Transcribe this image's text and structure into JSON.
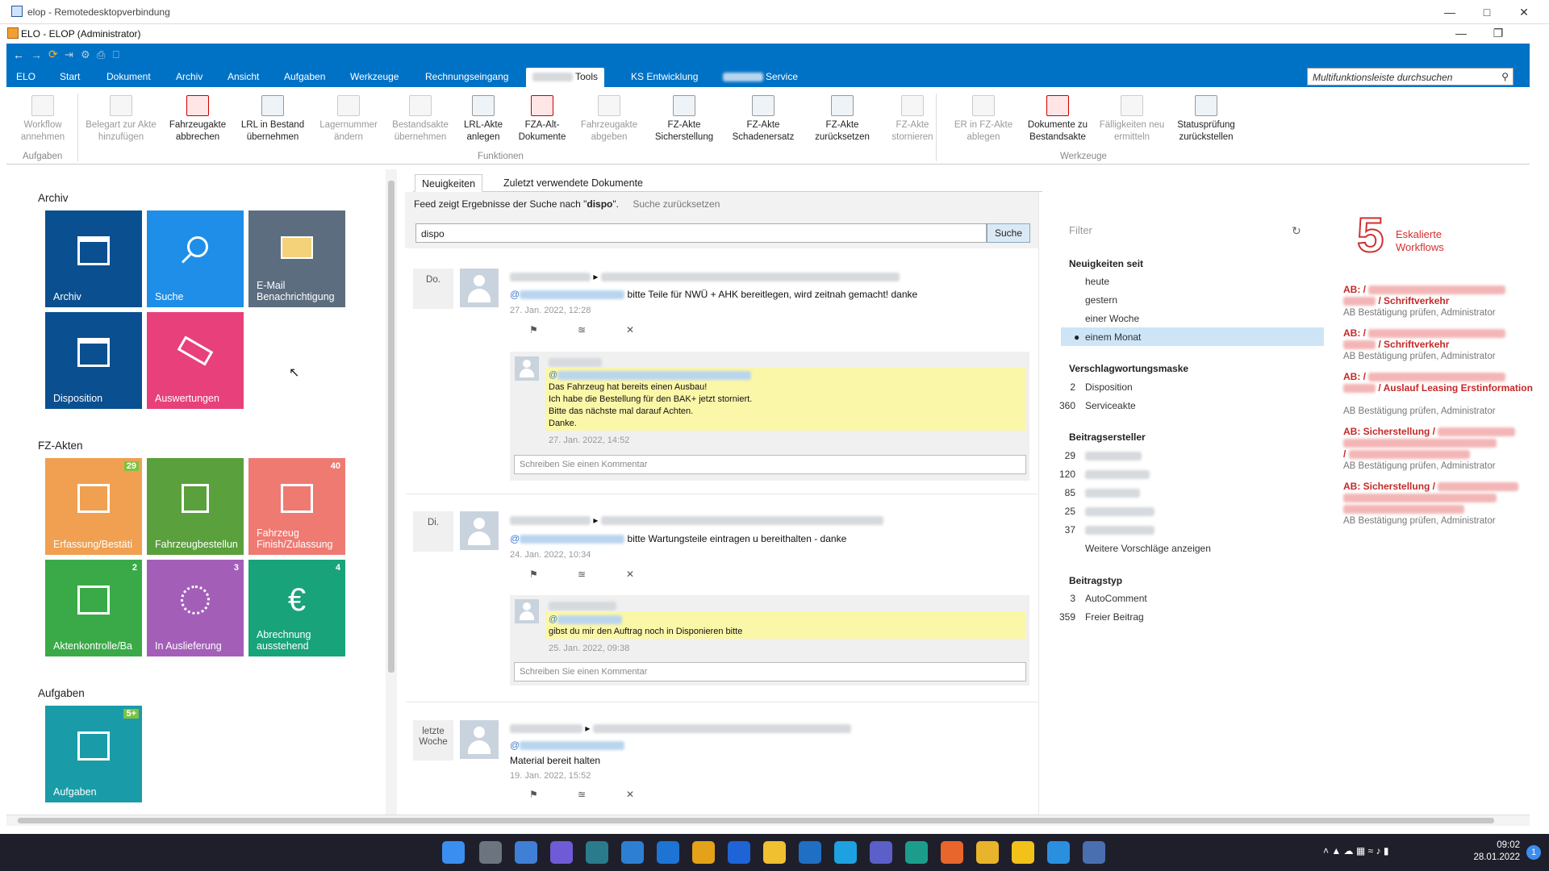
{
  "rdp_title": "elop - Remotedesktopverbindung",
  "app_title": "ELO - ELOP (Administrator)",
  "menu": [
    "ELO",
    "Start",
    "Dokument",
    "Archiv",
    "Ansicht",
    "Aufgaben",
    "Werkzeuge",
    "Rechnungseingang",
    "Tools",
    "KS Entwicklung",
    "Service"
  ],
  "search_placeholder": "Multifunktionsleiste durchsuchen",
  "ribbon": {
    "buttons": [
      {
        "label": "Workflow annehmen",
        "enabled": false
      },
      {
        "label": "Belegart zur Akte hinzufügen",
        "enabled": false
      },
      {
        "label": "Fahrzeugakte abbrechen",
        "enabled": true
      },
      {
        "label": "LRL in Bestand übernehmen",
        "enabled": true
      },
      {
        "label": "Lagernummer ändern",
        "enabled": false
      },
      {
        "label": "Bestandsakte übernehmen",
        "enabled": false
      },
      {
        "label": "LRL-Akte anlegen",
        "enabled": true
      },
      {
        "label": "FZA-Alt-Dokumente",
        "enabled": true
      },
      {
        "label": "Fahrzeugakte abgeben",
        "enabled": false
      },
      {
        "label": "FZ-Akte Sicherstellung",
        "enabled": true
      },
      {
        "label": "FZ-Akte Schadenersatz",
        "enabled": true
      },
      {
        "label": "FZ-Akte zurücksetzen",
        "enabled": true
      },
      {
        "label": "FZ-Akte stornieren",
        "enabled": false
      },
      {
        "label": "ER in FZ-Akte ablegen",
        "enabled": false
      },
      {
        "label": "Dokumente zu Bestandsakte",
        "enabled": true
      },
      {
        "label": "Fälligkeiten neu ermitteln",
        "enabled": false
      },
      {
        "label": "Statusprüfung zurückstellen",
        "enabled": true
      }
    ],
    "groups": [
      "Aufgaben",
      "Funktionen",
      "Werkzeuge"
    ]
  },
  "sections": {
    "archiv": "Archiv",
    "fzakten": "FZ-Akten",
    "aufgaben": "Aufgaben"
  },
  "tiles": {
    "archiv": {
      "label": "Archiv",
      "color": "#0a4f8f"
    },
    "suche": {
      "label": "Suche",
      "color": "#1e8ee8"
    },
    "email": {
      "label": "E-Mail Benachrichtigung",
      "color": "#5b6d7e"
    },
    "disposition": {
      "label": "Disposition",
      "color": "#0a4f8f"
    },
    "auswertungen": {
      "label": "Auswertungen",
      "color": "#e8407a"
    },
    "erfassung": {
      "label": "Erfassung/Bestäti",
      "badge": "29",
      "color": "#f0a050"
    },
    "fahrzeugbestellung": {
      "label": "Fahrzeugbestellun",
      "color": "#5aa03c"
    },
    "finish": {
      "label": "Fahrzeug Finish/Zulassung",
      "badge": "40",
      "color": "#ee7a72"
    },
    "aktenkontrolle": {
      "label": "Aktenkontrolle/Ba",
      "badge": "2",
      "color": "#3aaa48"
    },
    "auslieferung": {
      "label": "In Auslieferung",
      "badge": "3",
      "color": "#a35fb8"
    },
    "abrechnung": {
      "label": "Abrechnung ausstehend",
      "badge": "4",
      "color": "#19a37a"
    },
    "aufgaben": {
      "label": "Aufgaben",
      "badge": "5+",
      "color": "#1a9ba8"
    }
  },
  "feed": {
    "tab1": "Neuigkeiten",
    "tab2": "Zuletzt verwendete Dokumente",
    "feed_info_prefix": "Feed zeigt Ergebnisse der Suche nach \"",
    "feed_info_term": "dispo",
    "feed_info_suffix": "\".",
    "reset": "Suche zurücksetzen",
    "search_value": "dispo",
    "search_button": "Suche",
    "comment_placeholder": "Schreiben Sie einen Kommentar",
    "posts": [
      {
        "day": "Do.",
        "text": "bitte Teile für NWÜ + AHK bereitlegen, wird zeitnah gemacht! danke",
        "time": "27. Jan. 2022, 12:28",
        "reply": {
          "lines": [
            "Das Fahrzeug hat bereits einen Ausbau!",
            "Ich habe die Bestellung für den BAK+ jetzt storniert.",
            "Bitte das nächste mal darauf Achten.",
            "Danke."
          ],
          "time": "27. Jan. 2022, 14:52"
        }
      },
      {
        "day": "Di.",
        "text": "bitte Wartungsteile eintragen u bereithalten - danke",
        "time": "24. Jan. 2022, 10:34",
        "reply": {
          "lines": [
            "gibst du mir den Auftrag noch in Disponieren bitte"
          ],
          "time": "25. Jan. 2022, 09:38"
        }
      },
      {
        "day": "letzte Woche",
        "text": "Material bereit halten",
        "time": "19. Jan. 2022, 15:52"
      }
    ]
  },
  "filter": {
    "title": "Filter",
    "since_title": "Neuigkeiten seit",
    "since": [
      "heute",
      "gestern",
      "einer Woche",
      "einem Monat"
    ],
    "since_selected": "einem Monat",
    "mask_title": "Verschlagwortungsmaske",
    "masks": [
      {
        "name": "Disposition",
        "count": "2"
      },
      {
        "name": "Serviceakte",
        "count": "360"
      }
    ],
    "author_title": "Beitragsersteller",
    "author_counts": [
      "29",
      "120",
      "85",
      "25",
      "37"
    ],
    "more": "Weitere Vorschläge anzeigen",
    "type_title": "Beitragstyp",
    "types": [
      {
        "name": "AutoComment",
        "count": "3"
      },
      {
        "name": "Freier Beitrag",
        "count": "359"
      }
    ]
  },
  "escalated": {
    "count": "5",
    "label_line1": "Eskalierte",
    "label_line2": "Workflows",
    "items": [
      {
        "prefix": "AB: /",
        "suffix": "/ Schriftverkehr",
        "sub": "AB Bestätigung prüfen, Administrator"
      },
      {
        "prefix": "AB: /",
        "suffix": "/ Schriftverkehr",
        "sub": "AB Bestätigung prüfen, Administrator"
      },
      {
        "prefix": "AB: /",
        "suffix": "/ Auslauf Leasing Erstinformation",
        "sub": "AB Bestätigung prüfen, Administrator"
      },
      {
        "prefix": "AB: Sicherstellung /",
        "suffix": "/",
        "sub": "AB Bestätigung prüfen, Administrator"
      },
      {
        "prefix": "AB: Sicherstellung /",
        "suffix": "",
        "sub": "AB Bestätigung prüfen, Administrator"
      }
    ]
  },
  "clock": {
    "time": "09:02",
    "date": "28.01.2022",
    "notifications": "1"
  }
}
